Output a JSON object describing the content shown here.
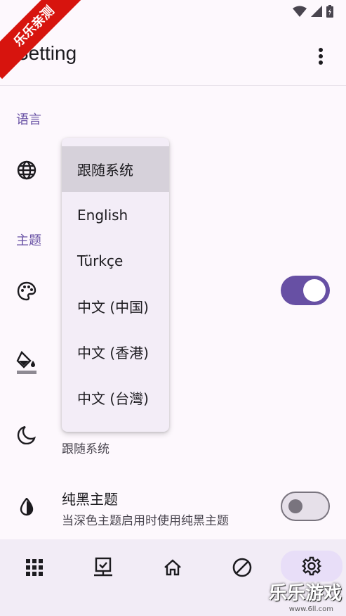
{
  "status_bar": {
    "icons": [
      "wifi-icon",
      "signal-icon",
      "battery-icon"
    ]
  },
  "app_bar": {
    "title": "Setting",
    "more_icon": "more-vert-icon"
  },
  "sections": {
    "language": {
      "header": "语言"
    },
    "theme": {
      "header": "主题"
    }
  },
  "rows": {
    "language": {
      "icon": "globe-icon"
    },
    "dynamic_color": {
      "icon": "palette-icon",
      "switch_on": true
    },
    "color_scheme": {
      "icon": "paint-bucket-icon"
    },
    "dark_mode": {
      "icon": "moon-icon",
      "subtitle": "跟随系统"
    },
    "black_theme": {
      "icon": "contrast-icon",
      "title": "纯黑主题",
      "subtitle": "当深色主题启用时使用纯黑主题",
      "switch_on": false
    }
  },
  "dropdown": {
    "options": [
      {
        "label": "跟随系统",
        "selected": true
      },
      {
        "label": "English",
        "selected": false
      },
      {
        "label": "Türkçe",
        "selected": false
      },
      {
        "label": "中文 (中国)",
        "selected": false
      },
      {
        "label": "中文 (香港)",
        "selected": false
      },
      {
        "label": "中文 (台灣)",
        "selected": false
      }
    ]
  },
  "nav": {
    "items": [
      {
        "icon": "apps-grid-icon",
        "active": false
      },
      {
        "icon": "computer-check-icon",
        "active": false
      },
      {
        "icon": "home-icon",
        "active": false
      },
      {
        "icon": "block-icon",
        "active": false
      },
      {
        "icon": "settings-gear-icon",
        "active": true
      }
    ]
  },
  "colors": {
    "accent": "#6750a4",
    "background": "#fdf8fd",
    "nav_background": "#f2ecf6",
    "watermark_red": "#d7140e"
  },
  "watermarks": {
    "ribbon": "乐乐亲测",
    "corner": "乐乐游戏",
    "url": "www.6ll.com"
  }
}
